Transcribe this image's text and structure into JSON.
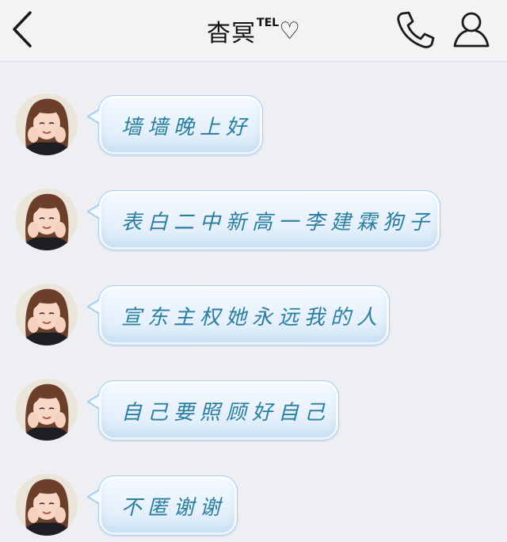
{
  "header": {
    "contact_name": "杳冥",
    "tel_badge": "TEL",
    "heart": "♡",
    "icons": {
      "back": "chevron-left-icon",
      "call": "phone-icon",
      "profile": "person-icon"
    }
  },
  "messages": [
    {
      "text": "墙墙晚上好"
    },
    {
      "text": "表白二中新高一李建霖狗子"
    },
    {
      "text": "宣东主权她永远我的人"
    },
    {
      "text": "自己要照顾好自己"
    },
    {
      "text": "不匿谢谢"
    }
  ],
  "colors": {
    "bubble_text": "#2a7e9f",
    "bubble_border": "#a9cfec",
    "background": "#edeff3"
  }
}
